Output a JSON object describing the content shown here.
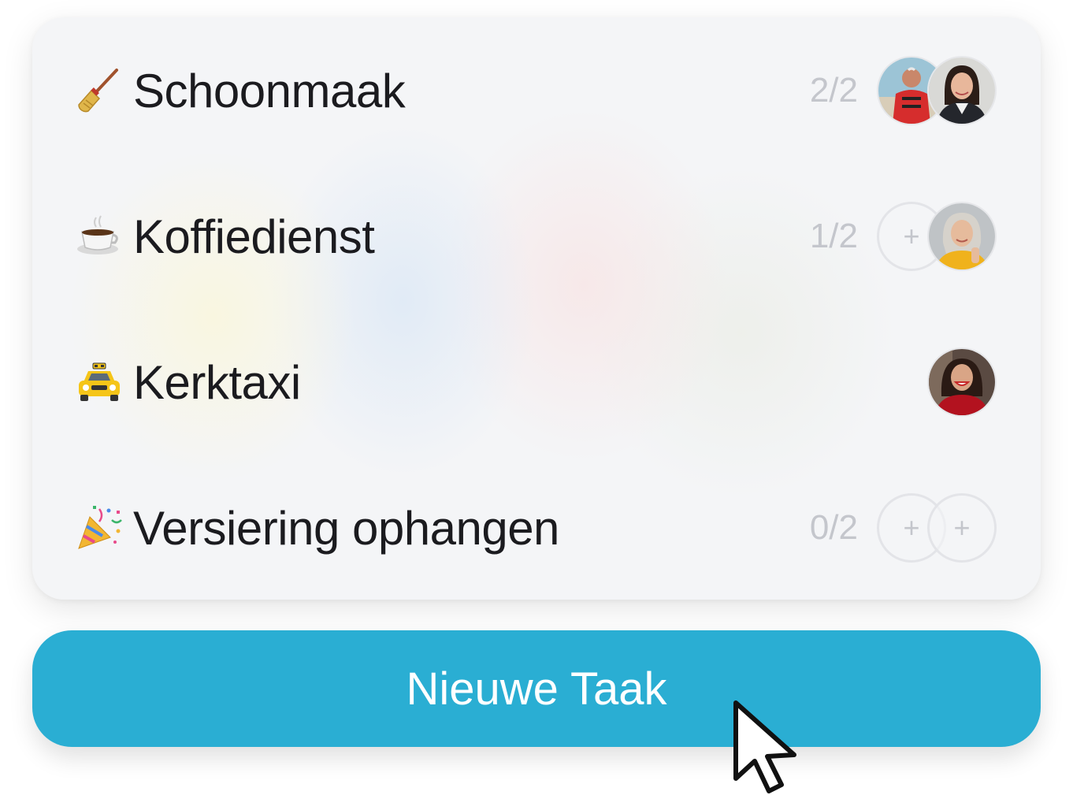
{
  "tasks": [
    {
      "emoji": "broom-icon",
      "label": "Schoonmaak",
      "count": "2/2",
      "assignees": [
        "avatar-man-lifevest",
        "avatar-woman-darkhair"
      ]
    },
    {
      "emoji": "coffee-icon",
      "label": "Koffiedienst",
      "count": "1/2",
      "assignees": [
        "empty-slot",
        "avatar-woman-grayhair"
      ]
    },
    {
      "emoji": "taxi-icon",
      "label": "Kerktaxi",
      "count": "",
      "assignees": [
        "avatar-woman-redtop"
      ]
    },
    {
      "emoji": "party-popper-icon",
      "label": "Versiering ophangen",
      "count": "0/2",
      "assignees": [
        "empty-slot",
        "empty-slot"
      ]
    }
  ],
  "slot_plus": "+",
  "new_task_button": {
    "label": "Nieuwe Taak"
  },
  "colors": {
    "button": "#2aaed3",
    "card": "#f4f5f7",
    "text": "#1b1b1f",
    "muted": "#c4c6cc"
  }
}
